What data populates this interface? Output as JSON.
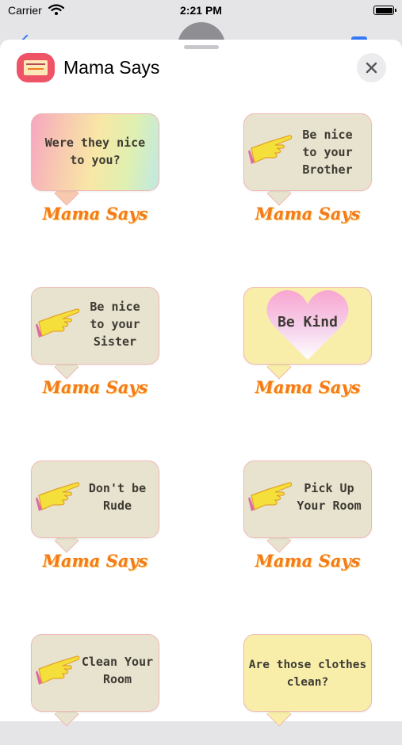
{
  "status_bar": {
    "carrier": "Carrier",
    "time": "2:21 PM"
  },
  "app": {
    "title": "Mama Says"
  },
  "stickers": [
    {
      "text": "Were they nice\nto you?",
      "caption": "Mama Says",
      "style": "rainbow",
      "icon": "none"
    },
    {
      "text": "Be nice\nto your\nBrother",
      "caption": "Mama Says",
      "style": "beige",
      "icon": "pointing-hand-icon"
    },
    {
      "text": "Be nice\nto your\nSister",
      "caption": "Mama Says",
      "style": "beige",
      "icon": "pointing-hand-icon"
    },
    {
      "text": "Be Kind",
      "caption": "Mama Says",
      "style": "yellow",
      "icon": "heart-icon"
    },
    {
      "text": "Don't be\nRude",
      "caption": "Mama Says",
      "style": "beige",
      "icon": "pointing-hand-icon"
    },
    {
      "text": "Pick Up\nYour Room",
      "caption": "Mama Says",
      "style": "beige",
      "icon": "pointing-hand-icon"
    },
    {
      "text": "Clean Your\nRoom",
      "caption": "",
      "style": "beige",
      "icon": "pointing-hand-icon"
    },
    {
      "text": "Are those clothes\nclean?",
      "caption": "",
      "style": "yellow",
      "icon": "none"
    }
  ],
  "colors": {
    "caption": "#f47a1a",
    "app_icon": "#ee5466",
    "bubble_beige": "#e8e3cf",
    "bubble_yellow": "#f8eeaa"
  }
}
